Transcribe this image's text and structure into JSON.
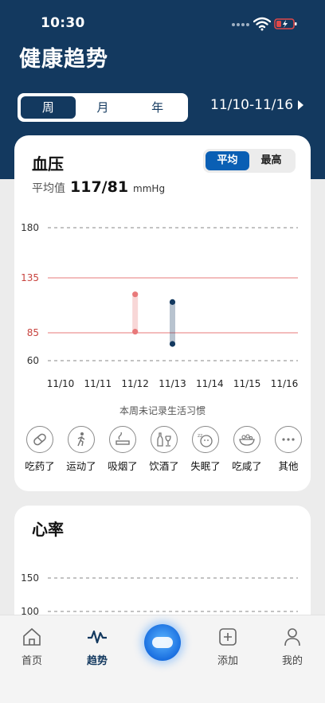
{
  "status_bar": {
    "time": "10:30"
  },
  "page": {
    "title": "健康趋势"
  },
  "period_tabs": [
    {
      "label": "周",
      "active": true
    },
    {
      "label": "月",
      "active": false
    },
    {
      "label": "年",
      "active": false
    }
  ],
  "date_range": "11/10-11/16",
  "bp_card": {
    "title": "血压",
    "mode_toggle": [
      {
        "label": "平均",
        "active": true
      },
      {
        "label": "最高",
        "active": false
      }
    ],
    "avg_label": "平均值",
    "avg_value": "117/81",
    "unit": "mmHg"
  },
  "chart_data": [
    {
      "type": "range-bar",
      "y_ticks": [
        180,
        135,
        85,
        60
      ],
      "reference_lines": [
        135,
        85
      ],
      "ylim": [
        60,
        180
      ],
      "categories": [
        "11/10",
        "11/11",
        "11/12",
        "11/13",
        "11/14",
        "11/15",
        "11/16"
      ],
      "points": [
        {
          "x": "11/12",
          "high": 120,
          "low": 86,
          "color": "#e8797a"
        },
        {
          "x": "11/13",
          "high": 113,
          "low": 75,
          "color": "#13395f"
        }
      ]
    },
    {
      "type": "line",
      "y_ticks": [
        150,
        100
      ]
    }
  ],
  "habits": {
    "note": "本周未记录生活习惯",
    "items": [
      {
        "label": "吃药了",
        "icon": "pill-icon"
      },
      {
        "label": "运动了",
        "icon": "walking-icon"
      },
      {
        "label": "吸烟了",
        "icon": "cigarette-icon"
      },
      {
        "label": "饮酒了",
        "icon": "wine-icon"
      },
      {
        "label": "失眠了",
        "icon": "sleep-icon"
      },
      {
        "label": "吃咸了",
        "icon": "salty-food-icon"
      },
      {
        "label": "其他",
        "icon": "more-icon"
      }
    ]
  },
  "hr_card": {
    "title": "心率"
  },
  "tabbar": [
    {
      "label": "首页",
      "icon": "home-icon",
      "active": false
    },
    {
      "label": "趋势",
      "icon": "trend-icon",
      "active": true
    },
    {
      "label": "添加",
      "icon": "add-icon",
      "active": false
    },
    {
      "label": "我的",
      "icon": "profile-icon",
      "active": false
    }
  ],
  "colors": {
    "header": "#13395f",
    "accent": "#0a5fb4",
    "ref_line": "#e8797a"
  }
}
